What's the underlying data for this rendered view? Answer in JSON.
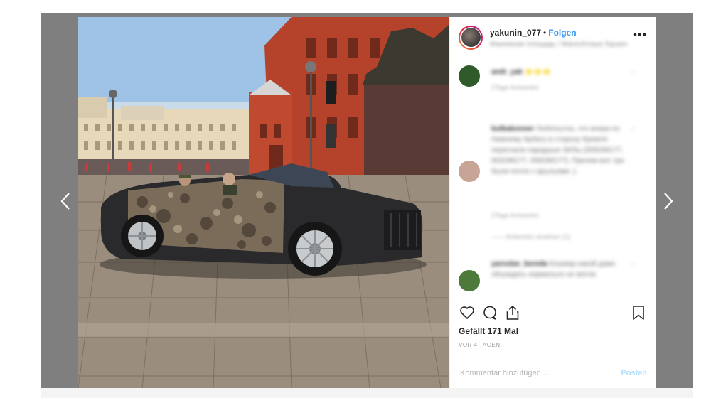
{
  "post": {
    "username": "yakunin_077",
    "separator": "•",
    "follow_label": "Folgen",
    "location": "Манежная площадь / Manezhnaya Square",
    "more_label": "•••"
  },
  "comments": [
    {
      "author": "andr_yak",
      "text": "⭐⭐⭐",
      "meta": "2Tage   Antworten",
      "avatar_color": "#2f5a2a"
    },
    {
      "author": "bulbakonner",
      "text": "Любопытно, что вчера по Нижнему Арбату в сторону Кремля перегнали парадные ЗИЛы (005ОМ177, 002ОМ177, 006ОМ177). Причем все три были почти с крыльями :)",
      "meta": "2Tage   Antworten",
      "replies": "——  Antworten ansehen (1)",
      "avatar_color": "#c7a495"
    },
    {
      "author": "yaroslav_bereda",
      "text": "Кошмар какой даже обсуждать нормально не могли",
      "meta": "2Tage   Antworten",
      "avatar_color": "#4d7a3a"
    }
  ],
  "actions": {
    "likes_text": "Gefällt 171 Mal",
    "timestamp": "VOR 4 TAGEN"
  },
  "comment_bar": {
    "placeholder": "Kommentar hinzufügen ...",
    "post_label": "Posten"
  },
  "navigation": {
    "prev_symbol": "‹",
    "next_symbol": "›"
  },
  "colors": {
    "overlay": "#7f7f7f",
    "accent": "#3897f0",
    "post_disabled": "#b2dffc"
  }
}
